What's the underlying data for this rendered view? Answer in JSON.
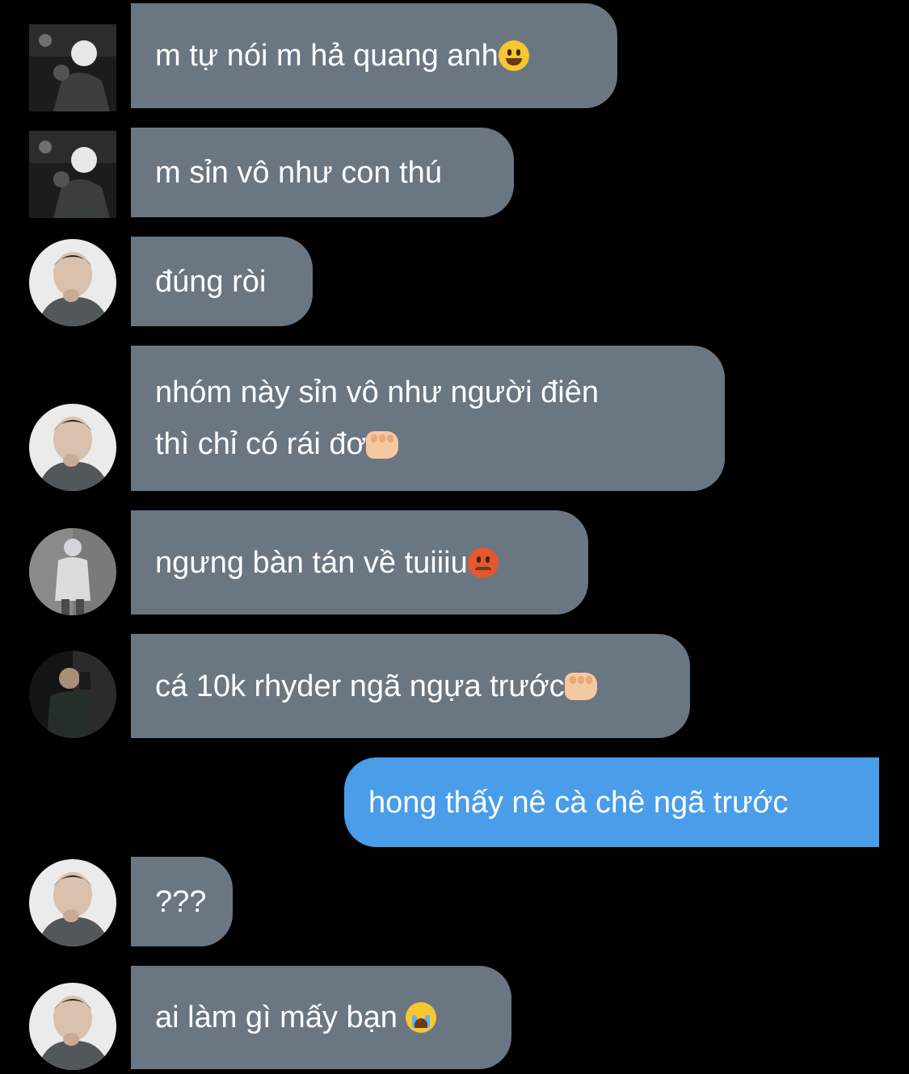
{
  "messages": [
    {
      "sender": "avatar-1",
      "text": "m tự nói m hả quang anh",
      "emoji": "grinning-face-emoji",
      "direction": "in"
    },
    {
      "sender": "avatar-1",
      "text": "m sỉn vô như con thú",
      "direction": "in"
    },
    {
      "sender": "avatar-2",
      "text": "đúng ròi",
      "direction": "in"
    },
    {
      "sender": "avatar-2",
      "lines": [
        "nhóm này sỉn vô như người điên",
        "thì chỉ có rái đơ"
      ],
      "emoji": "fist-emoji",
      "direction": "in"
    },
    {
      "sender": "avatar-3",
      "text": "ngưng bàn tán về tuiiiu",
      "emoji": "angry-face-emoji",
      "direction": "in"
    },
    {
      "sender": "avatar-4",
      "text": "cá 10k rhyder ngã ngựa trước",
      "emoji": "fist-emoji",
      "direction": "in"
    },
    {
      "sender": "me",
      "text": "hong thấy nê cà chê ngã trước",
      "direction": "out"
    },
    {
      "sender": "avatar-2",
      "text": "???",
      "direction": "in"
    },
    {
      "sender": "avatar-2",
      "text": "ai làm gì mấy bạn ",
      "emoji": "loudly-crying-face-emoji",
      "direction": "in"
    }
  ],
  "colors": {
    "background": "#000000",
    "incoming_bubble": "#6b7683",
    "outgoing_bubble": "#4a9de8",
    "text": "#ffffff"
  }
}
